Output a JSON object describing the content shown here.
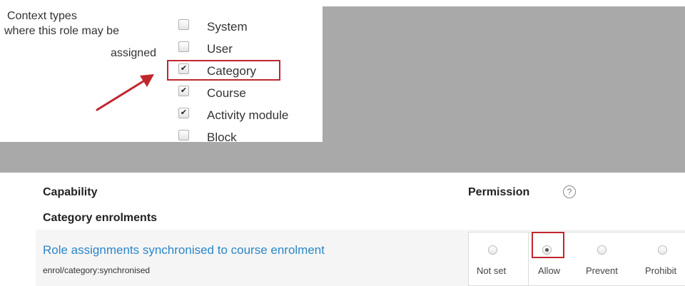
{
  "context": {
    "label_line1": "Context types",
    "label_line2": "where this role may be",
    "label_line3": "assigned",
    "items": [
      {
        "label": "System",
        "checked": false
      },
      {
        "label": "User",
        "checked": false
      },
      {
        "label": "Category",
        "checked": true
      },
      {
        "label": "Course",
        "checked": true
      },
      {
        "label": "Activity module",
        "checked": true
      },
      {
        "label": "Block",
        "checked": false
      }
    ]
  },
  "table": {
    "capability_header": "Capability",
    "permission_header": "Permission",
    "help_icon": "question-circle-icon",
    "section_title": "Category enrolments",
    "row": {
      "name": "Role assignments synchronised to course enrolment",
      "identifier": "enrol/category:synchronised",
      "options": [
        {
          "label": "Not set",
          "checked": false
        },
        {
          "label": "Allow",
          "checked": true
        },
        {
          "label": "Prevent",
          "checked": false
        },
        {
          "label": "Prohibit",
          "checked": false
        }
      ]
    }
  },
  "colors": {
    "highlight": "#c0272d",
    "link": "#2a87c8",
    "backdrop": "#a9a9a9"
  }
}
